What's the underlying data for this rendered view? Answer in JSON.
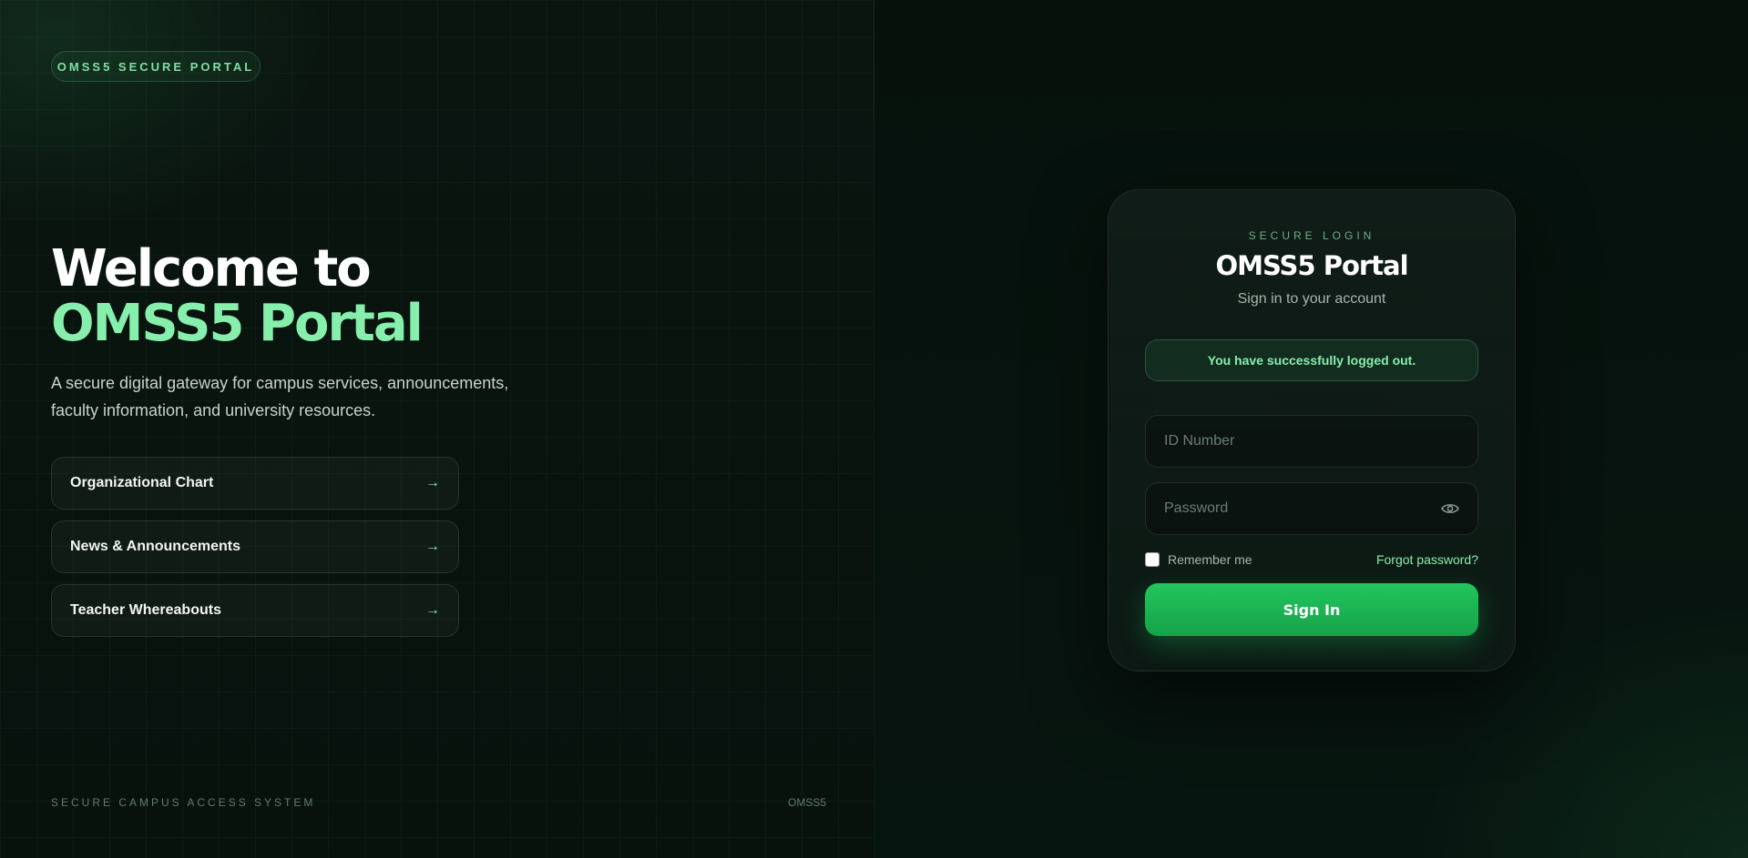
{
  "brand_badge": "OMSS5 SECURE PORTAL",
  "hero": {
    "title_line1": "Welcome to",
    "title_line2": "OMSS5 Portal",
    "description": "A secure digital gateway for campus services, announcements, faculty information, and university resources."
  },
  "quick_links": [
    {
      "label": "Organizational Chart",
      "arrow": "→"
    },
    {
      "label": "News & Announcements",
      "arrow": "→"
    },
    {
      "label": "Teacher Whereabouts",
      "arrow": "→"
    }
  ],
  "footer": {
    "left": "SECURE CAMPUS ACCESS SYSTEM",
    "right": "OMSS5"
  },
  "login": {
    "eyebrow": "SECURE LOGIN",
    "title": "OMSS5 Portal",
    "subtitle": "Sign in to your account",
    "alert": "You have successfully logged out.",
    "id_placeholder": "ID Number",
    "id_value": "",
    "password_placeholder": "Password",
    "password_value": "",
    "remember_label": "Remember me",
    "remember_checked": false,
    "forgot_label": "Forgot password?",
    "submit_label": "Sign In"
  },
  "icons": {
    "link_arrow": "arrow-right-icon",
    "password_toggle": "eye-icon"
  },
  "colors": {
    "accent": "#86efac",
    "button": "#22c55e",
    "background": "#07120d"
  }
}
